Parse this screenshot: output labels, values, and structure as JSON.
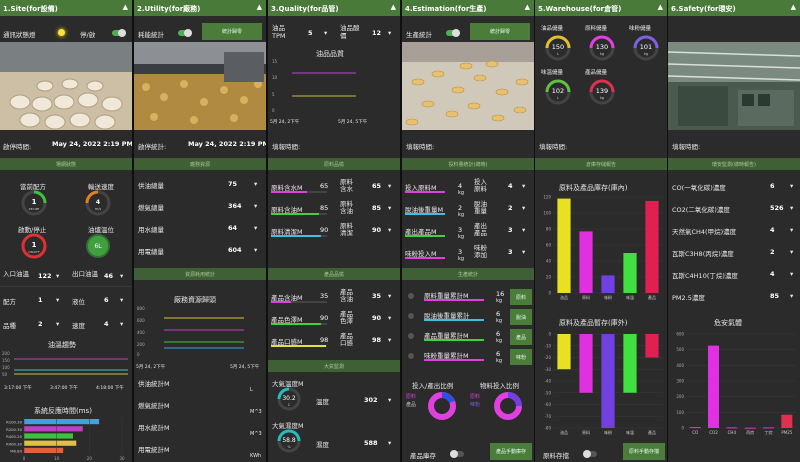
{
  "timestamp": "May 24, 2022 2:19 PM",
  "c1": {
    "title": "1.Site(for設備)",
    "status_label": "通訊狀態燈",
    "toggle_label": "停/啟",
    "start_label": "啟停時間:",
    "section1": "場網狀態",
    "gauge1": "當前配方",
    "gauge1_val": "1",
    "gauge1_sub": "RECIPE",
    "gauge2": "輸送速度",
    "gauge2_val": "4",
    "gauge2_sub": "m/s",
    "gauge3": "啟動/停止",
    "gauge3_val": "1",
    "gauge3_sub": "ON/OFF",
    "gauge4": "油爐溫位",
    "gauge4_val": "6L",
    "sels": [
      {
        "a": "入口油溫",
        "av": "122",
        "b": "出口油溫",
        "bv": "46"
      },
      {
        "a": "配方",
        "av": "1",
        "b": "液位",
        "bv": "6"
      },
      {
        "a": "品種",
        "av": "2",
        "b": "速度",
        "bv": "4"
      }
    ],
    "oil_trend": "油溫趨勢",
    "trend_t": [
      "3:17:00 下午",
      "3:47:00 下午",
      "4:18:00 下午"
    ],
    "trend_y": [
      "200",
      "150",
      "100",
      "50",
      "0"
    ],
    "resp_title": "系統反應時間(ms)",
    "resp_rows": [
      {
        "n": "R100.30",
        "v": 23
      },
      {
        "n": "R200.30",
        "v": 18
      },
      {
        "n": "R400.20",
        "v": 15
      },
      {
        "n": "R400.30",
        "v": 16
      },
      {
        "n": "M6.80",
        "v": 12
      }
    ],
    "resp_x": [
      "0",
      "10",
      "20",
      "30"
    ]
  },
  "c2": {
    "title": "2.Utility(for廠務)",
    "toggle_label": "耗能統計",
    "btn": "統計歸零",
    "start_label": "啟停統計:",
    "section1": "廠務資源",
    "sels": [
      {
        "n": "供油總量",
        "v": "75"
      },
      {
        "n": "燃氣總量",
        "v": "364"
      },
      {
        "n": "用水總量",
        "v": "64"
      },
      {
        "n": "用電總量",
        "v": "604"
      }
    ],
    "section2": "資源耗用統計",
    "chart_title": "廠務資源歸頭",
    "chart_y": [
      "800",
      "600",
      "400",
      "200",
      "0"
    ],
    "chart_x": [
      "5月 24, 2下午",
      "5月 24, 5下午"
    ],
    "rows": [
      {
        "n": "供油統計M",
        "u": "L"
      },
      {
        "n": "燃氣統計M",
        "u": "M^3"
      },
      {
        "n": "用水統計M",
        "u": "M^3"
      },
      {
        "n": "用電統計M",
        "u": "KWh"
      }
    ]
  },
  "c3": {
    "title": "3.Quality(for品管)",
    "a_label": "油品TPM",
    "a_val": "5",
    "b_label": "油品酸價",
    "b_val": "12",
    "chart_title": "油品品質",
    "chart_y": [
      "15",
      "10",
      "5",
      "0"
    ],
    "chart_x": [
      "5月 24, 2下午",
      "5月 24, 5下午"
    ],
    "start_label": "填報時間:",
    "section1": "原料品檢",
    "raw": [
      {
        "n": "原料含水M",
        "p": "65",
        "s": "原料含水",
        "v": "65",
        "c": "#e040e0"
      },
      {
        "n": "原料含油M",
        "p": "85",
        "s": "原料含油",
        "v": "85",
        "c": "#40d040"
      },
      {
        "n": "原料清潔M",
        "p": "90",
        "s": "原料清潔",
        "v": "90",
        "c": "#40c0e0"
      }
    ],
    "section2": "產品品檢",
    "prod": [
      {
        "n": "產品含油M",
        "p": "35",
        "s": "產品含油",
        "v": "35",
        "c": "#e040e0"
      },
      {
        "n": "產品色澤M",
        "p": "90",
        "s": "產品色澤",
        "v": "90",
        "c": "#40d040"
      },
      {
        "n": "產品口感M",
        "p": "98",
        "s": "產品口感",
        "v": "98",
        "c": "#e0e040"
      }
    ],
    "section3": "大氣監測",
    "g1": "大氣溫度M",
    "g1v": "30.2",
    "g1u": "C",
    "g1s": "溫度",
    "g1sv": "302",
    "g2": "大氣濕度M",
    "g2v": "58.8",
    "g2u": "%",
    "g2s": "濕度",
    "g2sv": "588"
  },
  "c4": {
    "title": "4.Estimation(for生產)",
    "toggle_label": "生產統計",
    "btn": "統計歸零",
    "start_label": "填報時間:",
    "section1": "投料量統計(總時)",
    "rows": [
      {
        "n": "投入原料M",
        "v": "4",
        "u": "kg",
        "s": "投入原料",
        "sv": "4"
      },
      {
        "n": "脫油後重量M",
        "v": "2",
        "u": "kg",
        "s": "脫油重量",
        "sv": "2"
      },
      {
        "n": "產出產品M",
        "v": "3",
        "u": "kg",
        "s": "產出產品",
        "sv": "3"
      },
      {
        "n": "味粉投入M",
        "v": "3",
        "u": "kg",
        "s": "味粉添加",
        "sv": "3"
      }
    ],
    "section2": "生產統計",
    "prod": [
      {
        "n": "原料重量累計M",
        "v": "16",
        "u": "kg",
        "b": "原料"
      },
      {
        "n": "脫油後重量累計",
        "v": "6",
        "u": "kg",
        "b": "脫油"
      },
      {
        "n": "產品重量累計M",
        "v": "6",
        "u": "kg",
        "b": "產品"
      },
      {
        "n": "味粉重量累計M",
        "v": "6",
        "u": "kg",
        "b": "味粉"
      }
    ],
    "pie1": "投入/產出比例",
    "pie1_legend": [
      "原料",
      "產品"
    ],
    "pie2": "物料投入比例",
    "pie2_legend": [
      "原料",
      "味粉"
    ],
    "inv_label": "產品庫存",
    "inv_btn": "產品手動庫存"
  },
  "c5": {
    "title": "5.Warehouse(for倉管)",
    "gauges": [
      {
        "n": "油品儲量",
        "v": "150",
        "u": "L",
        "c": "#e0c030"
      },
      {
        "n": "原料儲量",
        "v": "130",
        "u": "kg",
        "c": "#e040e0"
      },
      {
        "n": "味粉儲量",
        "v": "101",
        "u": "kg",
        "c": "#8060e0"
      },
      {
        "n": "味溫儲量",
        "v": "102",
        "u": "L",
        "c": "#60c040"
      },
      {
        "n": "產品儲量",
        "v": "139",
        "u": "kg",
        "c": "#e03050"
      }
    ],
    "start_label": "填報時間:",
    "section1": "倉庫存儲報告",
    "chart1_title": "原料及產品庫存(庫內)",
    "chart2_title": "原料及產品暫存(庫外)",
    "inv_label": "原料存擋",
    "inv_btn": "原料手動存擋"
  },
  "c6": {
    "title": "6.Safety(for環安)",
    "start_label": "填報時間:",
    "section1": "環安監測(總時報告)",
    "rows": [
      {
        "n": "CO(一氧化碳)濃度",
        "v": "6"
      },
      {
        "n": "CO2(二氧化碳)濃度",
        "v": "526"
      },
      {
        "n": "天然氣CH4(甲烷)濃度",
        "v": "4"
      },
      {
        "n": "瓦斯C3H8(丙烷)濃度",
        "v": "2"
      },
      {
        "n": "瓦斯C4H10(丁烷)濃度",
        "v": "4"
      },
      {
        "n": "PM2.5濃度",
        "v": "85"
      }
    ],
    "chart_title": "危安氣體"
  },
  "chart_data": [
    {
      "type": "bar",
      "title": "原料及產品庫存(庫內)",
      "categories": [
        "油品",
        "原料",
        "味粉",
        "味溫",
        "產品"
      ],
      "values": [
        118,
        77,
        22,
        50,
        115
      ],
      "ylim": [
        0,
        120
      ],
      "colors": [
        "#e8e020",
        "#e030e0",
        "#7040e0",
        "#40e040",
        "#e02050"
      ]
    },
    {
      "type": "bar",
      "title": "原料及產品暫存(庫外)",
      "categories": [
        "油品",
        "原料",
        "味粉",
        "味溫",
        "產品"
      ],
      "values": [
        -30,
        -50,
        -80,
        -50,
        -20
      ],
      "ylim": [
        -80,
        0
      ],
      "colors": [
        "#e8e020",
        "#e030e0",
        "#7040e0",
        "#40e040",
        "#e02050"
      ]
    },
    {
      "type": "bar",
      "title": "危安氣體",
      "categories": [
        "CO",
        "CO2",
        "CH4",
        "丙烷",
        "丁烷",
        "PM25"
      ],
      "values": [
        6,
        526,
        4,
        2,
        4,
        85
      ],
      "ylim": [
        0,
        600
      ],
      "colors": [
        "#e030e0",
        "#e030e0",
        "#e030e0",
        "#e030e0",
        "#e030e0",
        "#e03050"
      ]
    },
    {
      "type": "bar",
      "title": "系統反應時間(ms)",
      "categories": [
        "R100.30",
        "R200.30",
        "R400.20",
        "R400.30",
        "M6.80"
      ],
      "values": [
        23,
        18,
        15,
        16,
        12
      ],
      "xlim": [
        0,
        30
      ]
    }
  ]
}
